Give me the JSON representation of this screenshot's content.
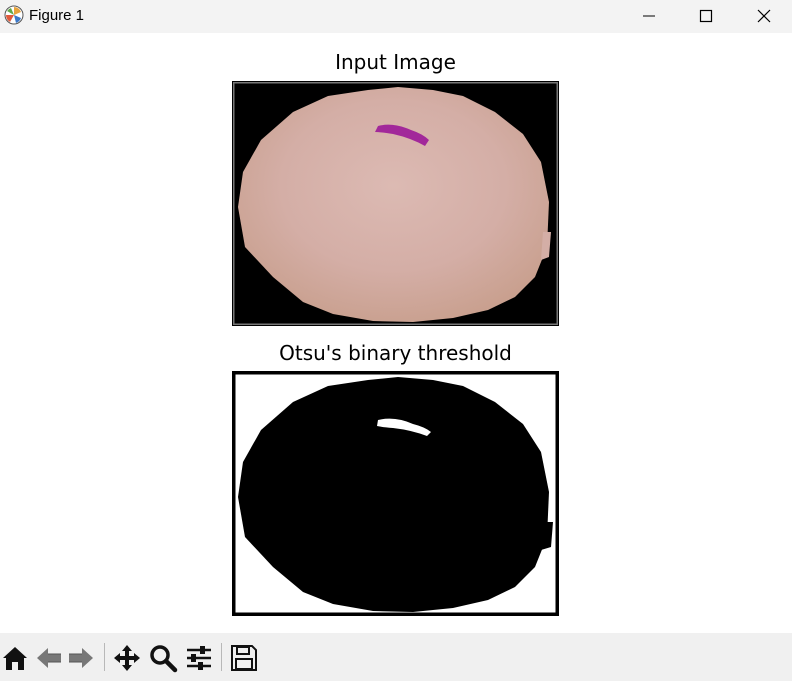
{
  "window": {
    "title": "Figure 1",
    "icon": "matplotlib-icon",
    "controls": [
      "minimize-icon",
      "maximize-icon",
      "close-icon"
    ]
  },
  "figure": {
    "subplots": [
      {
        "title": "Input Image",
        "content": "blood-cell-color-image"
      },
      {
        "title": "Otsu's binary threshold",
        "content": "binary-threshold-image"
      }
    ]
  },
  "toolbar": {
    "buttons": [
      "home-icon",
      "back-icon",
      "forward-icon",
      "pan-icon",
      "zoom-icon",
      "configure-subplots-icon",
      "save-icon"
    ]
  },
  "colors": {
    "cell": "#d8b0a6",
    "parasite": "#a2289a",
    "background": "#000000"
  }
}
